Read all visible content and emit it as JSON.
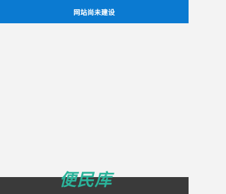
{
  "header": {
    "title": "网站尚未建设"
  },
  "footer": {
    "logo_text": "便民库"
  },
  "colors": {
    "header_bg": "#0b7ad1",
    "page_bg": "#f3f3f3",
    "footer_bg": "#3a3a3a",
    "logo": "#2bb39a"
  }
}
